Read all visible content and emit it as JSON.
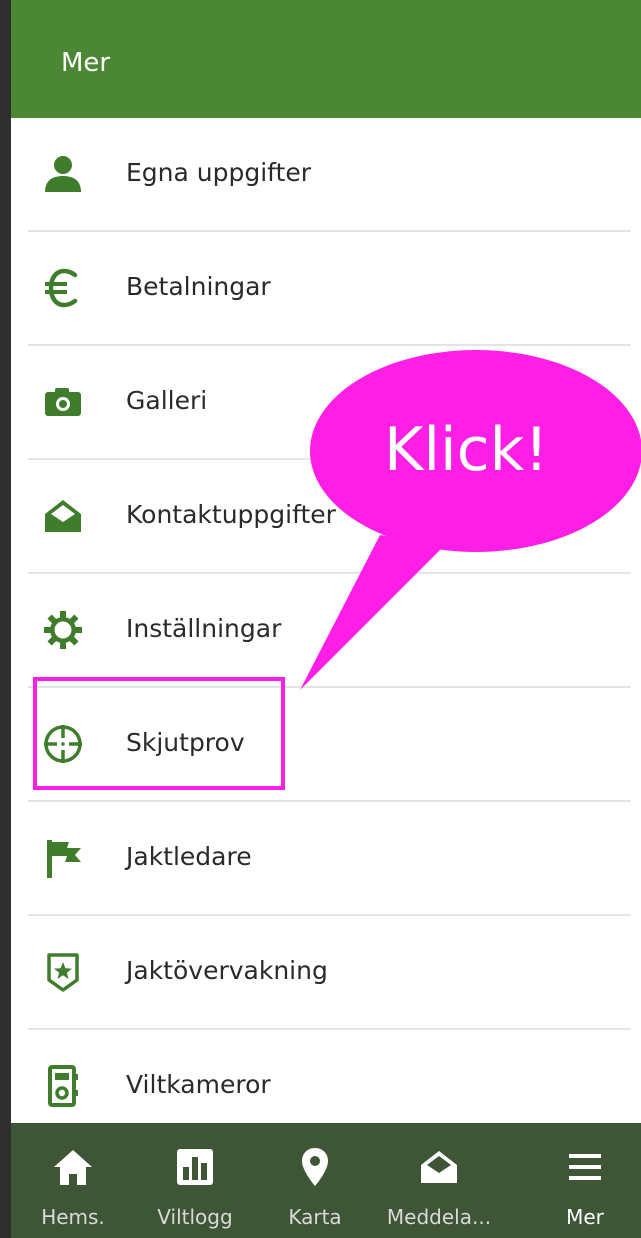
{
  "header": {
    "title": "Mer"
  },
  "menu": {
    "items": [
      {
        "label": "Egna uppgifter",
        "icon": "user-icon"
      },
      {
        "label": "Betalningar",
        "icon": "euro-icon"
      },
      {
        "label": "Galleri",
        "icon": "camera-icon"
      },
      {
        "label": "Kontaktuppgifter",
        "icon": "envelope-open-icon"
      },
      {
        "label": "Inställningar",
        "icon": "gear-icon"
      },
      {
        "label": "Skjutprov",
        "icon": "crosshair-icon"
      },
      {
        "label": "Jaktledare",
        "icon": "flag-icon"
      },
      {
        "label": "Jaktövervakning",
        "icon": "shield-star-icon"
      },
      {
        "label": "Viltkameror",
        "icon": "trail-camera-icon"
      }
    ]
  },
  "callout": {
    "text": "Klick!"
  },
  "bottom_nav": {
    "items": [
      {
        "label": "Hems.",
        "icon": "home-icon"
      },
      {
        "label": "Viltlogg",
        "icon": "bar-chart-icon"
      },
      {
        "label": "Karta",
        "icon": "map-pin-icon"
      },
      {
        "label": "Meddela...",
        "icon": "envelope-open-icon"
      },
      {
        "label": "Mer",
        "icon": "hamburger-menu-icon"
      }
    ]
  },
  "colors": {
    "header": "#4c8733",
    "icon_green": "#3f7d2c",
    "bottom_bar": "#3e5636",
    "callout": "#ff1ee6"
  }
}
